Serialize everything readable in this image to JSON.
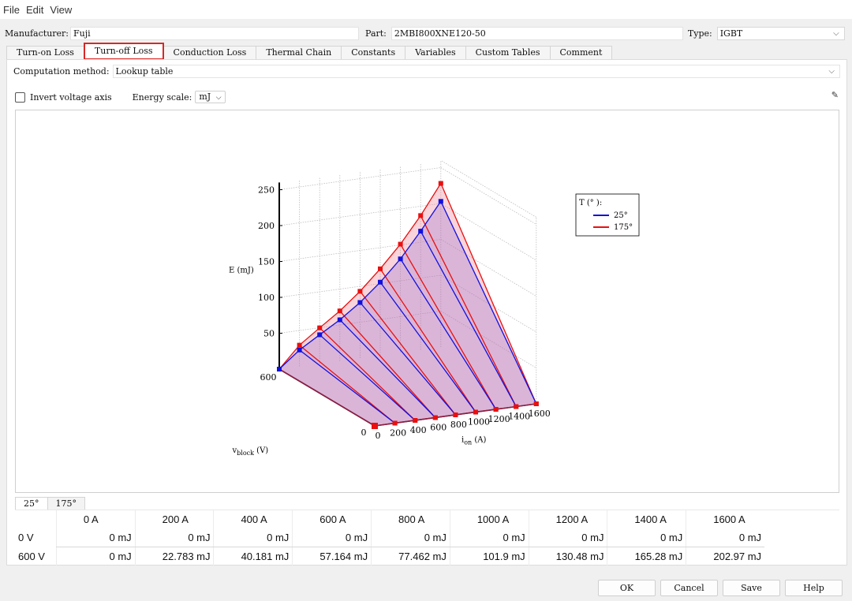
{
  "menu": [
    "File",
    "Edit",
    "View"
  ],
  "header": {
    "manufacturer_label": "Manufacturer:",
    "manufacturer_value": "Fuji",
    "part_label": "Part:",
    "part_value": "2MBI800XNE120-50",
    "type_label": "Type:",
    "type_value": "IGBT"
  },
  "tabs": [
    "Turn-on Loss",
    "Turn-off Loss",
    "Conduction Loss",
    "Thermal Chain",
    "Constants",
    "Variables",
    "Custom Tables",
    "Comment"
  ],
  "active_tab": "Turn-off Loss",
  "computation": {
    "label": "Computation method:",
    "value": "Lookup table"
  },
  "options": {
    "invert_label": "Invert voltage axis",
    "invert_checked": false,
    "energy_scale_label": "Energy scale:",
    "energy_scale_value": "mJ"
  },
  "chart_data": {
    "type": "surface3d",
    "z_label": "E (mJ)",
    "x_label_main": "i",
    "x_label_sub": "on",
    "x_label_unit": "(A)",
    "y_label_main": "v",
    "y_label_sub": "block",
    "y_label_unit": "(V)",
    "z_ticks": [
      "50",
      "100",
      "150",
      "200",
      "250"
    ],
    "current_ticks": [
      "0",
      "200",
      "400",
      "600",
      "800",
      "1000",
      "1200",
      "1400",
      "1600"
    ],
    "voltage_ticks": [
      "0",
      "600"
    ],
    "current": [
      0,
      200,
      400,
      600,
      800,
      1000,
      1200,
      1400,
      1600
    ],
    "voltage": [
      0,
      600
    ],
    "legend_title": "T (° ):",
    "grid": true,
    "series": [
      {
        "name": "25°",
        "color": "#1010e0",
        "voltage": 600,
        "values": [
          0,
          22.783,
          40.181,
          57.164,
          77.462,
          101.9,
          130.48,
          165.28,
          202.97
        ]
      },
      {
        "name": "175°",
        "color": "#e81010",
        "voltage": 600,
        "values": [
          0,
          29.5,
          49.8,
          69.5,
          93.0,
          120.5,
          151.0,
          187.0,
          228.0
        ]
      }
    ]
  },
  "temp_tabs": [
    "25°",
    "175°"
  ],
  "table": {
    "headers": [
      "0 A",
      "200 A",
      "400 A",
      "600 A",
      "800 A",
      "1000 A",
      "1200 A",
      "1400 A",
      "1600 A"
    ],
    "rows": [
      {
        "label": "0 V",
        "values": [
          "0 mJ",
          "0 mJ",
          "0 mJ",
          "0 mJ",
          "0 mJ",
          "0 mJ",
          "0 mJ",
          "0 mJ",
          "0 mJ"
        ]
      },
      {
        "label": "600 V",
        "values": [
          "0 mJ",
          "22.783 mJ",
          "40.181 mJ",
          "57.164 mJ",
          "77.462 mJ",
          "101.9 mJ",
          "130.48 mJ",
          "165.28 mJ",
          "202.97 mJ"
        ]
      }
    ]
  },
  "buttons": {
    "ok": "OK",
    "cancel": "Cancel",
    "save": "Save",
    "help": "Help"
  }
}
